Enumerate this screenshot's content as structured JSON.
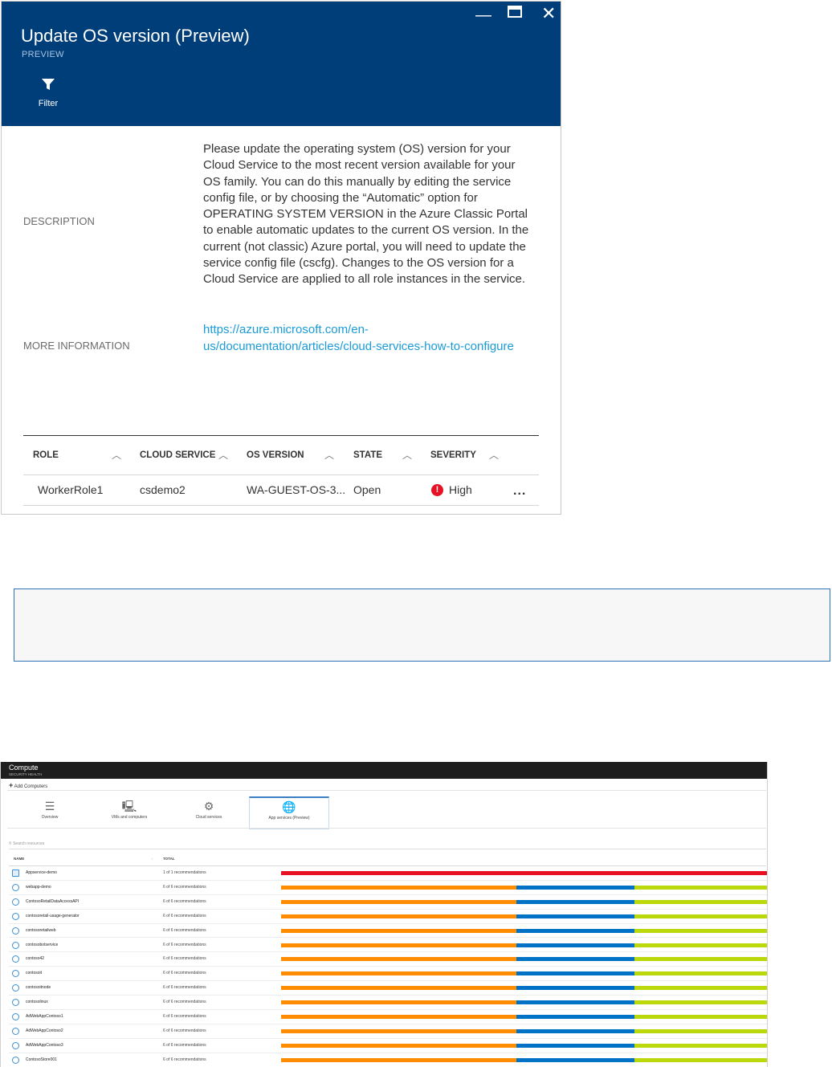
{
  "blade": {
    "title": "Update OS version (Preview)",
    "subtitle": "PREVIEW",
    "controls": {
      "minimize": "—",
      "maximize": "☐",
      "close": "✕"
    },
    "filter_label": "Filter",
    "description_label": "DESCRIPTION",
    "description_text": "Please update the operating system (OS) version for your Cloud Service to the most recent version available for your OS family. You can do this manually by editing the service config file, or by choosing the “Automatic” option for OPERATING SYSTEM VERSION in the Azure Classic Portal to enable automatic updates to the current OS version. In the current (not classic) Azure portal, you will need to update the service config file (cscfg). Changes to the OS version for a Cloud Service are applied to all role instances in the service.",
    "more_info_label": "MORE INFORMATION",
    "more_info_link": "https://azure.microsoft.com/en-us/documentation/articles/cloud-services-how-to-configure",
    "columns": [
      "ROLE",
      "CLOUD SERVICE",
      "OS VERSION",
      "STATE",
      "SEVERITY"
    ],
    "row": {
      "role": "WorkerRole1",
      "cloud_service": "csdemo2",
      "os_version": "WA-GUEST-OS-3...",
      "state": "Open",
      "severity": "High",
      "more": "..."
    }
  },
  "compute": {
    "title": "Compute",
    "subtitle": "SECURITY HEALTH",
    "add_computers": "Add Computers",
    "tabs": [
      {
        "label": "Overview",
        "icon": "list-icon"
      },
      {
        "label": "VMs and computers",
        "icon": "computers-icon"
      },
      {
        "label": "Cloud services",
        "icon": "gears-icon"
      },
      {
        "label": "App services (Preview)",
        "icon": "globe-icon"
      }
    ],
    "search_placeholder": "Search resources",
    "col_name": "NAME",
    "col_total": "TOTAL",
    "colors": {
      "high": "#e81123",
      "orange": "#ff8c00",
      "blue": "#0072c6",
      "green": "#bad80a"
    },
    "rows": [
      {
        "name": "Appservice-demo",
        "total": "1 of 1 recommendations",
        "segments": [
          1,
          0,
          0,
          0
        ]
      },
      {
        "name": "webapp-demo",
        "total": "6 of 6 recommendations",
        "segments": [
          0,
          3,
          1.5,
          1.7
        ]
      },
      {
        "name": "ContosoRetailDataAccessAPI",
        "total": "6 of 6 recommendations",
        "segments": [
          0,
          3,
          1.5,
          1.7
        ]
      },
      {
        "name": "contosoretail-usage-generator",
        "total": "6 of 6 recommendations",
        "segments": [
          0,
          3,
          1.5,
          1.7
        ]
      },
      {
        "name": "contosoretailweb",
        "total": "6 of 6 recommendations",
        "segments": [
          0,
          3,
          1.5,
          1.7
        ]
      },
      {
        "name": "contosobotservice",
        "total": "6 of 6 recommendations",
        "segments": [
          0,
          3,
          1.5,
          1.7
        ]
      },
      {
        "name": "contoso42",
        "total": "6 of 6 recommendations",
        "segments": [
          0,
          3,
          1.5,
          1.7
        ]
      },
      {
        "name": "contosoit",
        "total": "6 of 6 recommendations",
        "segments": [
          0,
          3,
          1.5,
          1.7
        ]
      },
      {
        "name": "contosoitnode",
        "total": "6 of 6 recommendations",
        "segments": [
          0,
          3,
          1.5,
          1.7
        ]
      },
      {
        "name": "contosolinux",
        "total": "6 of 6 recommendations",
        "segments": [
          0,
          3,
          1.5,
          1.7
        ]
      },
      {
        "name": "AdWebAppContoso1",
        "total": "6 of 6 recommendations",
        "segments": [
          0,
          3,
          1.5,
          1.7
        ]
      },
      {
        "name": "AdWebAppContoso2",
        "total": "6 of 6 recommendations",
        "segments": [
          0,
          3,
          1.5,
          1.7
        ]
      },
      {
        "name": "AdWebAppContoso3",
        "total": "6 of 6 recommendations",
        "segments": [
          0,
          3,
          1.5,
          1.7
        ]
      },
      {
        "name": "ContosoStore001",
        "total": "6 of 6 recommendations",
        "segments": [
          0,
          3,
          1.5,
          1.7
        ]
      }
    ]
  }
}
